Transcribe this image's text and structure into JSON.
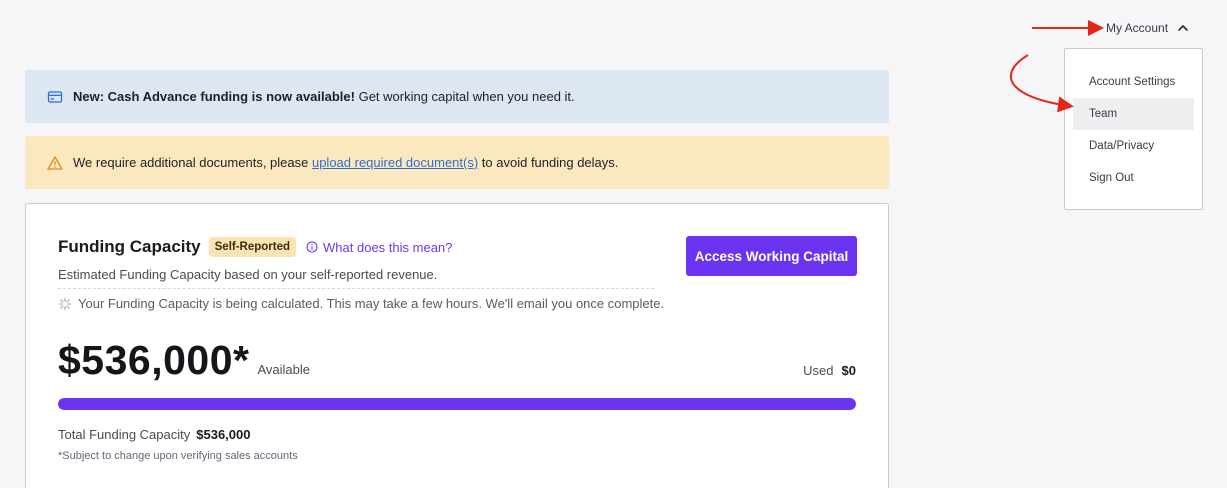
{
  "header": {
    "account_label": "My Account",
    "toggle_icon": "chevron-up-icon"
  },
  "account_menu": {
    "items": [
      {
        "label": "Account Settings",
        "active": false
      },
      {
        "label": "Team",
        "active": true
      },
      {
        "label": "Data/Privacy",
        "active": false
      },
      {
        "label": "Sign Out",
        "active": false
      }
    ]
  },
  "annotations": {
    "arrow_color": "#e3251b"
  },
  "banners": {
    "info": {
      "icon": "credit-card-icon",
      "strong_text": "New: Cash Advance funding is now available!",
      "text": " Get working capital when you need it.",
      "bg_color": "#dce7f3"
    },
    "warning": {
      "icon": "warning-triangle-icon",
      "text_before": "We require additional documents, please ",
      "link_text": "upload required document(s)",
      "text_after": " to avoid funding delays.",
      "bg_color": "#fbe8bf"
    }
  },
  "funding": {
    "title": "Funding Capacity",
    "badge": "Self-Reported",
    "help_link": "What does this mean?",
    "subtitle": "Estimated Funding Capacity based on your self-reported revenue.",
    "calculating_text": "Your Funding Capacity is being calculated. This may take a few hours. We'll email you once complete.",
    "cta_label": "Access Working Capital",
    "amount": "$536,000*",
    "available_label": "Available",
    "used_label": "Used",
    "used_value": "$0",
    "progress_fraction": 1.0,
    "total_label": "Total Funding Capacity",
    "total_value": "$536,000",
    "footnote": "*Subject to change upon verifying sales accounts",
    "accent_color": "#6a33f0"
  }
}
